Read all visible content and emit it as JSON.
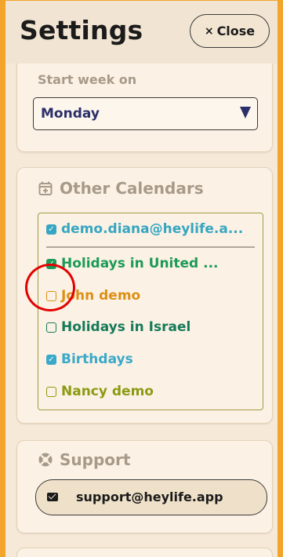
{
  "header": {
    "title": "Settings",
    "close_label": "Close",
    "close_icon": "×"
  },
  "week": {
    "label": "Start week on",
    "selected": "Monday"
  },
  "calendars": {
    "heading": "Other Calendars",
    "items": [
      {
        "label": "demo.diana@heylife.a...",
        "checked": true,
        "color": "#36a6c2"
      },
      {
        "label": "Holidays in United ...",
        "checked": true,
        "color": "#1c9a57"
      },
      {
        "label": "John demo",
        "checked": false,
        "color": "#dd8f14"
      },
      {
        "label": "Holidays in Israel",
        "checked": false,
        "color": "#157a5a"
      },
      {
        "label": "Birthdays",
        "checked": true,
        "color": "#3aa9c9"
      },
      {
        "label": "Nancy demo",
        "checked": false,
        "color": "#8c9a12"
      }
    ]
  },
  "support": {
    "heading": "Support",
    "email": "support@heylife.app"
  },
  "colors": {
    "accent_border": "#f2a52a",
    "card_bg": "#fbf1e4",
    "section_heading": "#a89a88",
    "highlight_ring": "#e30000"
  }
}
